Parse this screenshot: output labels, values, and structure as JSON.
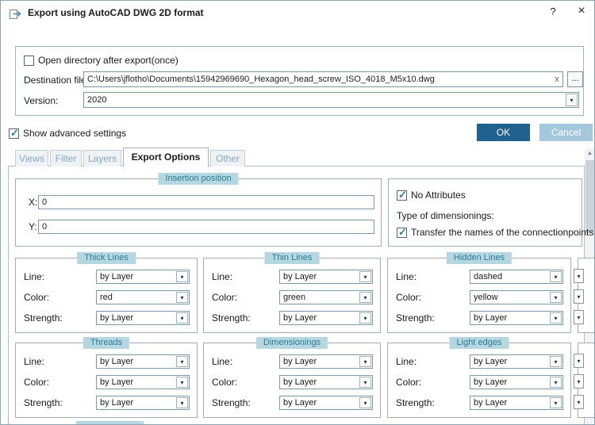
{
  "window": {
    "title": "Export using AutoCAD DWG 2D format",
    "help_label": "?",
    "close_label": "×"
  },
  "top_section": {
    "open_directory_label": "Open directory after export(once)",
    "destination_label": "Destination file:",
    "destination_value": "C:\\Users\\jflotho\\Documents\\15942969690_Hexagon_head_screw_ISO_4018_M5x10.dwg",
    "clear_label": "x",
    "browse_label": "...",
    "version_label": "Version:",
    "version_value": "2020"
  },
  "actions": {
    "show_advanced_label": "Show advanced settings",
    "ok_label": "OK",
    "cancel_label": "Cancel"
  },
  "tabs": [
    {
      "label": "Views",
      "active": false
    },
    {
      "label": "Filter",
      "active": false
    },
    {
      "label": "Layers",
      "active": false
    },
    {
      "label": "Export Options",
      "active": true
    },
    {
      "label": "Other",
      "active": false
    }
  ],
  "insertion": {
    "title": "Insertion position",
    "x_label": "X:",
    "x_value": "0",
    "y_label": "Y:",
    "y_value": "0"
  },
  "attributes": {
    "no_attributes_label": "No Attributes",
    "type_of_dimensionings_label": "Type of dimensionings:",
    "transfer_label": "Transfer the names of the connectionpoints"
  },
  "labels": {
    "line": "Line:",
    "color": "Color:",
    "strength": "Strength:"
  },
  "line_groups": [
    {
      "title": "Thick Lines",
      "line": "by Layer",
      "color": "red",
      "strength": "by Layer"
    },
    {
      "title": "Thin Lines",
      "line": "by Layer",
      "color": "green",
      "strength": "by Layer"
    },
    {
      "title": "Hidden Lines",
      "line": "dashed",
      "color": "yellow",
      "strength": "by Layer"
    },
    {
      "title": "Threads",
      "line": "by Layer",
      "color": "by Layer",
      "strength": "by Layer"
    },
    {
      "title": "Dimensionings",
      "line": "by Layer",
      "color": "by Layer",
      "strength": "by Layer"
    },
    {
      "title": "Light edges",
      "line": "by Layer",
      "color": "by Layer",
      "strength": "by Layer"
    }
  ],
  "states": {
    "open_directory_checked": false,
    "show_advanced_checked": true,
    "no_attributes_checked": true,
    "transfer_names_checked": true
  },
  "colors": {
    "accent_header_bg": "#b5d7e2",
    "accent_header_text": "#2e7a91",
    "ok_bg": "#1f618f",
    "cancel_bg": "#a3c8de",
    "check": "#2b7bb9"
  }
}
